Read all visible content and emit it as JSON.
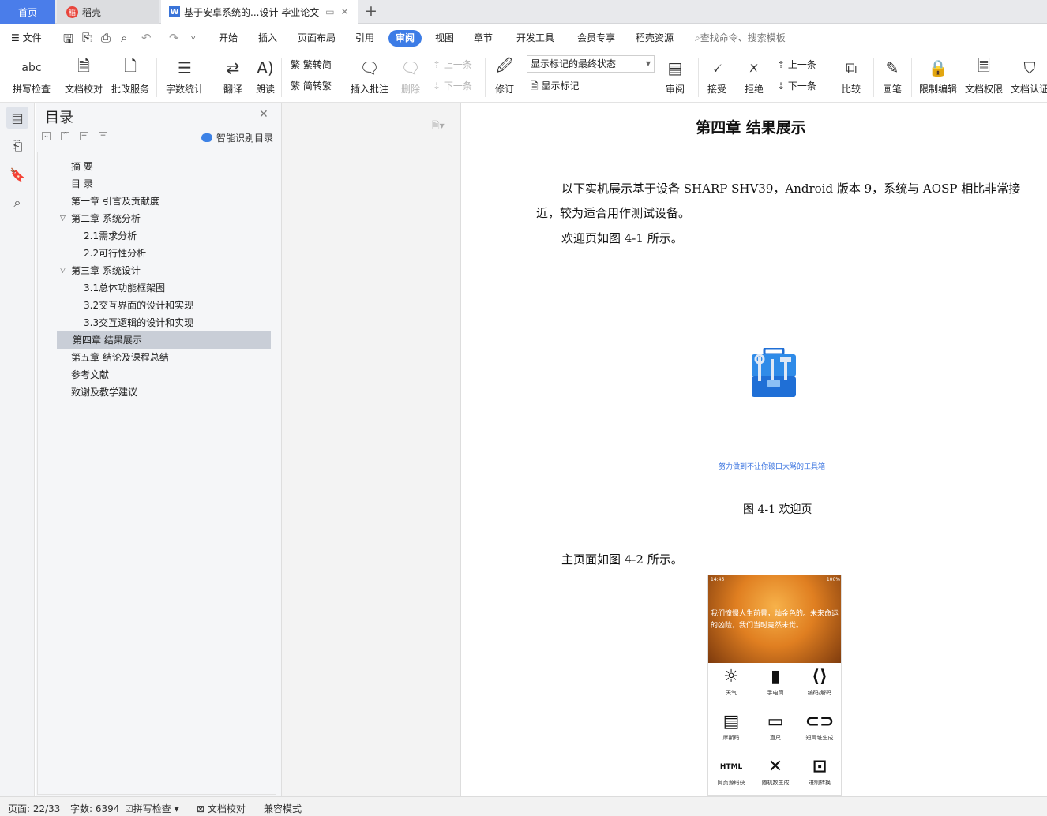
{
  "tabs": {
    "home": "首页",
    "daoke": "稻壳",
    "doc": "基于安卓系统的...设计 毕业论文"
  },
  "menu": {
    "file": "文件",
    "items": [
      "开始",
      "插入",
      "页面布局",
      "引用",
      "审阅",
      "视图",
      "章节",
      "开发工具",
      "会员专享",
      "稻壳资源"
    ],
    "active": "审阅",
    "search_placeholder": "查找命令、搜索模板"
  },
  "ribbon": {
    "spell": "拼写检查",
    "proof": "文档校对",
    "review_service": "批改服务",
    "word_count": "字数统计",
    "translate": "翻译",
    "read_aloud": "朗读",
    "trad_to_simp": "繁转简",
    "simp_to_trad": "简转繁",
    "insert_comment": "插入批注",
    "delete": "删除",
    "prev1": "上一条",
    "next1": "下一条",
    "track": "修订",
    "markup_state": "显示标记的最终状态",
    "show_markup": "显示标记",
    "review": "审阅",
    "accept": "接受",
    "reject": "拒绝",
    "prev2": "上一条",
    "next2": "下一条",
    "compare": "比较",
    "pen": "画笔",
    "restrict_edit": "限制编辑",
    "doc_rights": "文档权限",
    "doc_cert": "文档认证"
  },
  "toc": {
    "title": "目录",
    "smart": "智能识别目录",
    "items": [
      {
        "label": "摘  要"
      },
      {
        "label": "目  录"
      },
      {
        "label": "第一章  引言及贡献度"
      },
      {
        "label": "第二章  系统分析"
      },
      {
        "label": "2.1需求分析"
      },
      {
        "label": "2.2可行性分析"
      },
      {
        "label": "第三章  系统设计"
      },
      {
        "label": "3.1总体功能框架图"
      },
      {
        "label": "3.2交互界面的设计和实现"
      },
      {
        "label": "3.3交互逻辑的设计和实现"
      },
      {
        "label": "第四章  结果展示"
      },
      {
        "label": "第五章  结论及课程总结"
      },
      {
        "label": "参考文献"
      },
      {
        "label": "致谢及教学建议"
      }
    ]
  },
  "doc": {
    "heading": "第四章    结果展示",
    "p1_line1": "以下实机展示基于设备  SHARP SHV39，Android 版本 9，系统与  AOSP 相比非常接",
    "p1_line2": "近，较为适合用作测试设备。",
    "p2": "欢迎页如图  4-1 所示。",
    "slogan": "努力做到不让你破口大骂的工具箱",
    "fig1_caption": "图 4-1 欢迎页",
    "p3": "主页面如图  4-2 所示。",
    "phone": {
      "time": "14:45",
      "battery": "100%",
      "quote": "我们憧憬人生前景，灿金色的。未来命运的凶险，我们当时竟然未觉。",
      "tiles": [
        "天气",
        "手电筒",
        "编码/解码",
        "摩斯码",
        "直尺",
        "短网址生成",
        "网页源码获",
        "随机数生成",
        "进制转换"
      ],
      "html_icon": "HTML"
    }
  },
  "status": {
    "page": "页面: 22/33",
    "words": "字数: 6394",
    "spell": "拼写检查",
    "proof": "文档校对",
    "compat": "兼容模式"
  },
  "colors": {
    "accent": "#3c7ce6",
    "home_tab": "#4a7dea",
    "toc_selected": "#c9ced7",
    "slogan": "#3b74e0"
  }
}
